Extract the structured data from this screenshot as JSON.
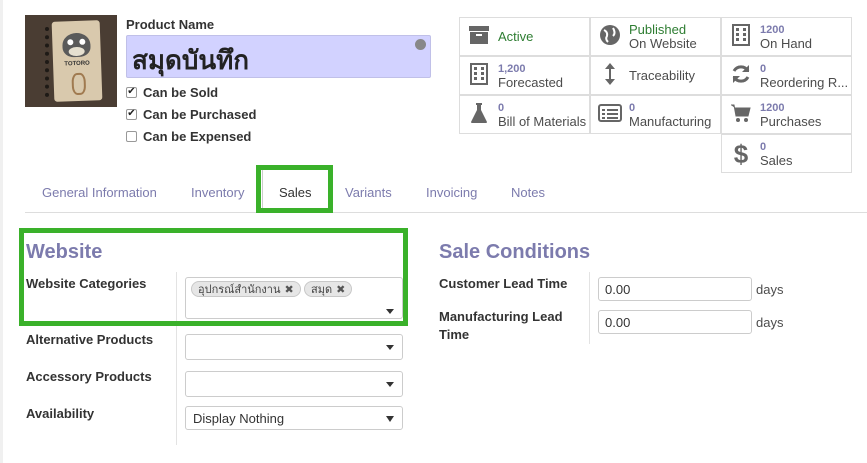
{
  "product": {
    "name_label": "Product Name",
    "name_value": "สมุดบันทึก",
    "image_brand": "TOTORO"
  },
  "checkboxes": [
    {
      "label": "Can be Sold",
      "checked": true
    },
    {
      "label": "Can be Purchased",
      "checked": true
    },
    {
      "label": "Can be Expensed",
      "checked": false
    }
  ],
  "smart_buttons": {
    "active": {
      "label": "Active",
      "icon": "archive-icon"
    },
    "published": {
      "line1": "Published",
      "line2": "On Website",
      "icon": "globe-icon"
    },
    "on_hand": {
      "count": "1200",
      "label": "On Hand",
      "icon": "building-icon"
    },
    "forecasted": {
      "count": "1,200",
      "label": "Forecasted",
      "icon": "building-icon"
    },
    "traceability": {
      "label": "Traceability",
      "icon": "arrows-vertical-icon"
    },
    "reordering": {
      "count": "0",
      "label": "Reordering R...",
      "icon": "refresh-icon"
    },
    "bom": {
      "count": "0",
      "label": "Bill of Materials",
      "icon": "flask-icon"
    },
    "manufacturing": {
      "count": "0",
      "label": "Manufacturing",
      "icon": "list-icon"
    },
    "purchases": {
      "count": "1200",
      "label": "Purchases",
      "icon": "cart-icon"
    },
    "sales": {
      "count": "0",
      "label": "Sales",
      "icon": "dollar-icon"
    }
  },
  "tabs": [
    "General Information",
    "Inventory",
    "Sales",
    "Variants",
    "Invoicing",
    "Notes"
  ],
  "active_tab": "Sales",
  "website": {
    "title": "Website",
    "categories_label": "Website Categories",
    "categories": [
      "อุปกรณ์สำนักงาน",
      "สมุด"
    ],
    "alternative_label": "Alternative Products",
    "accessory_label": "Accessory Products",
    "availability_label": "Availability",
    "availability_value": "Display Nothing"
  },
  "sale_conditions": {
    "title": "Sale Conditions",
    "customer_lead_label": "Customer Lead Time",
    "customer_lead_value": "0.00",
    "manufacturing_lead_label": "Manufacturing Lead Time",
    "manufacturing_lead_value": "0.00",
    "unit": "days"
  },
  "colors": {
    "highlight": "#3ab12a",
    "accent": "#7c7bad",
    "name_bg": "#d2d2ff"
  }
}
